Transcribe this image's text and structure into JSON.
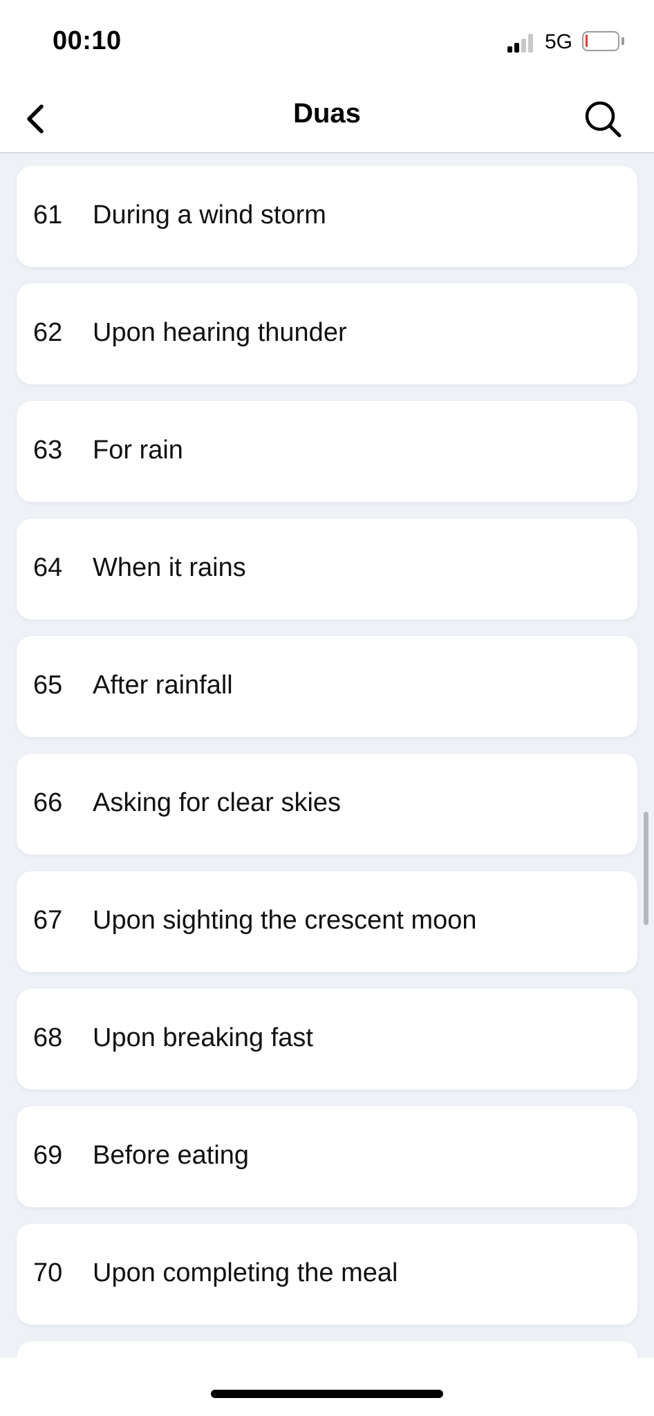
{
  "status_bar": {
    "time": "00:10",
    "network": "5G",
    "signal_bars_active": 2,
    "signal_bars_total": 4,
    "battery_level": 0.05,
    "battery_color": "#e53935"
  },
  "nav": {
    "title": "Duas",
    "back_icon": "chevron-left-icon",
    "search_icon": "search-icon"
  },
  "items": [
    {
      "number": "61",
      "title": "During a wind storm"
    },
    {
      "number": "62",
      "title": "Upon hearing thunder"
    },
    {
      "number": "63",
      "title": "For rain"
    },
    {
      "number": "64",
      "title": "When it rains"
    },
    {
      "number": "65",
      "title": "After rainfall"
    },
    {
      "number": "66",
      "title": "Asking for clear skies"
    },
    {
      "number": "67",
      "title": "Upon sighting the crescent moon"
    },
    {
      "number": "68",
      "title": "Upon breaking fast"
    },
    {
      "number": "69",
      "title": "Before eating"
    },
    {
      "number": "70",
      "title": "Upon completing the meal"
    },
    {
      "number": "",
      "title": ""
    }
  ],
  "colors": {
    "background": "#eef1f6",
    "card": "#ffffff",
    "text": "#111111"
  }
}
